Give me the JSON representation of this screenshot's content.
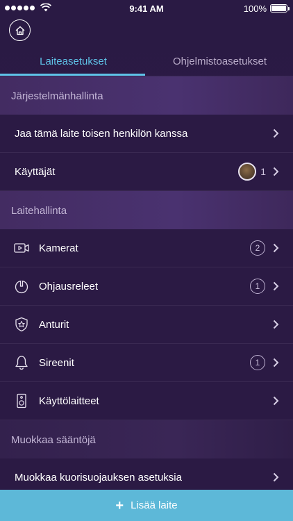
{
  "status_bar": {
    "time": "9:41 AM",
    "battery": "100%"
  },
  "tabs": [
    {
      "label": "Laiteasetukset",
      "active": true
    },
    {
      "label": "Ohjelmistoasetukset",
      "active": false
    }
  ],
  "sections": {
    "system": {
      "header": "Järjestelmänhallinta",
      "share_label": "Jaa tämä laite toisen henkilön kanssa",
      "users_label": "Käyttäjät",
      "users_count": "1"
    },
    "devices": {
      "header": "Laitehallinta",
      "cameras_label": "Kamerat",
      "cameras_count": "2",
      "relays_label": "Ohjausreleet",
      "relays_count": "1",
      "sensors_label": "Anturit",
      "sirens_label": "Sireenit",
      "sirens_count": "1",
      "terminals_label": "Käyttölaitteet"
    },
    "rules": {
      "header": "Muokkaa sääntöjä",
      "shell_label": "Muokkaa kuorisuojauksen asetuksia"
    }
  },
  "add_device": {
    "label": "Lisää laite"
  },
  "icons": [
    "home-icon",
    "camera-icon",
    "power-icon",
    "shield-star-icon",
    "bell-icon",
    "speaker-icon",
    "chevron-right-icon",
    "plus-icon"
  ],
  "colors": {
    "accent": "#5fc3e8",
    "add_bar": "#5db8d8",
    "background": "#2b1a44"
  }
}
